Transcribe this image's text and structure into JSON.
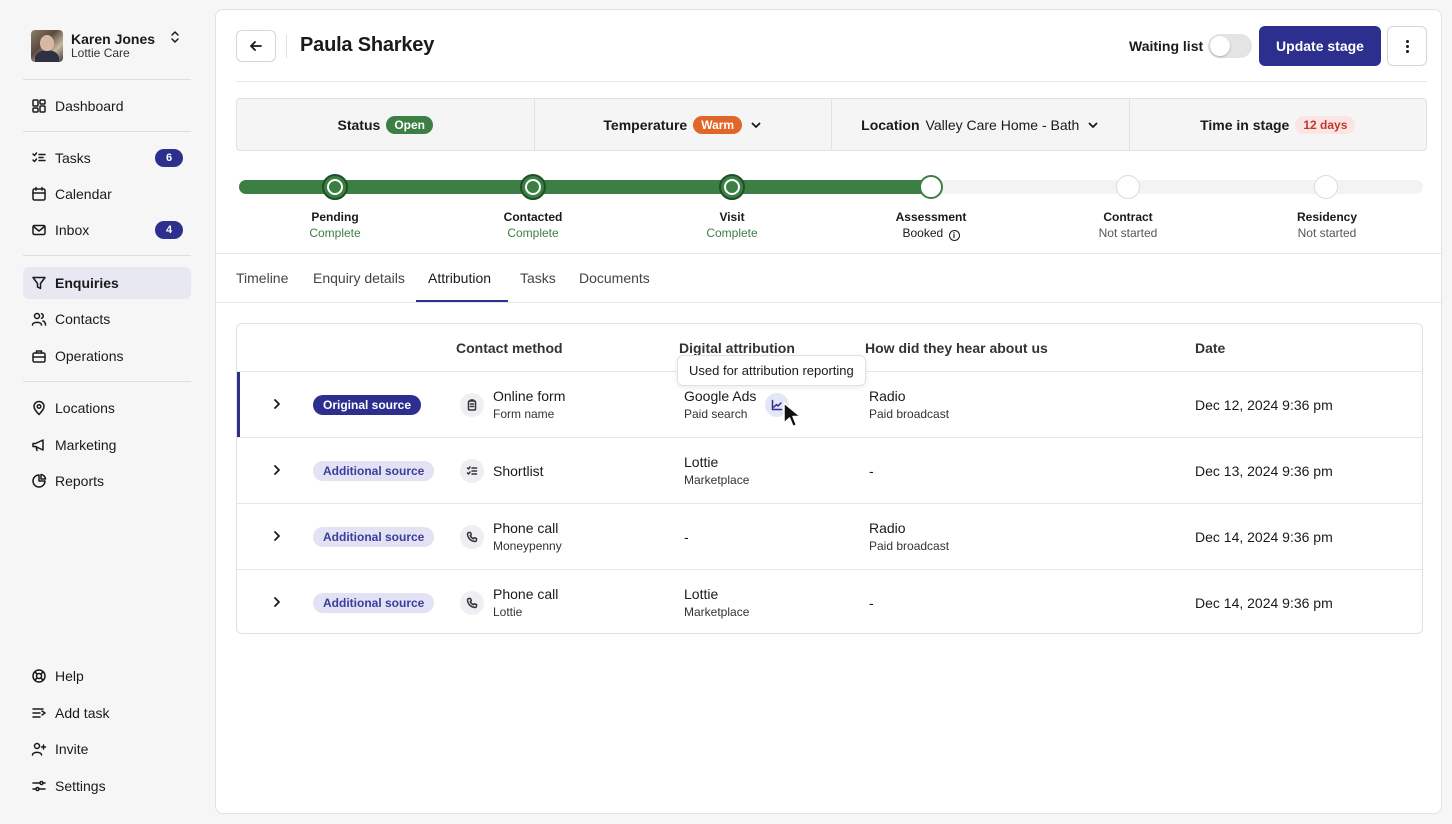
{
  "user": {
    "name": "Karen Jones",
    "org": "Lottie Care"
  },
  "nav": {
    "dashboard": "Dashboard",
    "tasks": "Tasks",
    "tasks_badge": "6",
    "calendar": "Calendar",
    "inbox": "Inbox",
    "inbox_badge": "4",
    "enquiries": "Enquiries",
    "contacts": "Contacts",
    "operations": "Operations",
    "locations": "Locations",
    "marketing": "Marketing",
    "reports": "Reports",
    "help": "Help",
    "add_task": "Add task",
    "invite": "Invite",
    "settings": "Settings"
  },
  "header": {
    "title": "Paula Sharkey",
    "waiting_list_label": "Waiting list",
    "update_stage_label": "Update stage"
  },
  "info": {
    "status_label": "Status",
    "status_value": "Open",
    "temperature_label": "Temperature",
    "temperature_value": "Warm",
    "location_label": "Location",
    "location_value": "Valley Care Home - Bath",
    "time_label": "Time in stage",
    "time_value": "12 days"
  },
  "stages": [
    {
      "name": "Pending",
      "status": "Complete"
    },
    {
      "name": "Contacted",
      "status": "Complete"
    },
    {
      "name": "Visit",
      "status": "Complete"
    },
    {
      "name": "Assessment",
      "status": "Booked"
    },
    {
      "name": "Contract",
      "status": "Not started"
    },
    {
      "name": "Residency",
      "status": "Not started"
    }
  ],
  "tabs": [
    "Timeline",
    "Enquiry details",
    "Attribution",
    "Tasks",
    "Documents"
  ],
  "table": {
    "headers": {
      "contact_method": "Contact method",
      "digital_attribution": "Digital attribution",
      "heard": "How did they hear about us",
      "date": "Date"
    },
    "tooltip": "Used for attribution reporting",
    "rows": [
      {
        "source": "Original source",
        "method": "Online form",
        "method_sub": "Form name",
        "digital": "Google Ads",
        "digital_sub": "Paid search",
        "heard": "Radio",
        "heard_sub": "Paid broadcast",
        "date": "Dec 12, 2024 9:36 pm"
      },
      {
        "source": "Additional source",
        "method": "Shortlist",
        "method_sub": "",
        "digital": "Lottie",
        "digital_sub": "Marketplace",
        "heard": "-",
        "heard_sub": "",
        "date": "Dec 13, 2024 9:36 pm"
      },
      {
        "source": "Additional source",
        "method": "Phone call",
        "method_sub": "Moneypenny",
        "digital": "-",
        "digital_sub": "",
        "heard": "Radio",
        "heard_sub": "Paid broadcast",
        "date": "Dec 14, 2024 9:36 pm"
      },
      {
        "source": "Additional source",
        "method": "Phone call",
        "method_sub": "Lottie",
        "digital": "Lottie",
        "digital_sub": "Marketplace",
        "heard": "-",
        "heard_sub": "",
        "date": "Dec 14, 2024 9:36 pm"
      }
    ]
  },
  "colors": {
    "brand": "#2d2f8f",
    "success": "#3c7f44",
    "warm": "#e0662a"
  },
  "icons": [
    "dashboard-icon",
    "tasks-icon",
    "calendar-icon",
    "inbox-icon",
    "filter-icon",
    "contacts-icon",
    "operations-icon",
    "location-pin-icon",
    "megaphone-icon",
    "reports-icon",
    "help-icon",
    "add-task-icon",
    "invite-icon",
    "settings-icon",
    "back-arrow-icon",
    "more-vertical-icon",
    "chevron-down-icon",
    "chevron-right-icon",
    "clipboard-icon",
    "list-icon",
    "phone-icon",
    "chart-icon",
    "cursor-icon"
  ]
}
